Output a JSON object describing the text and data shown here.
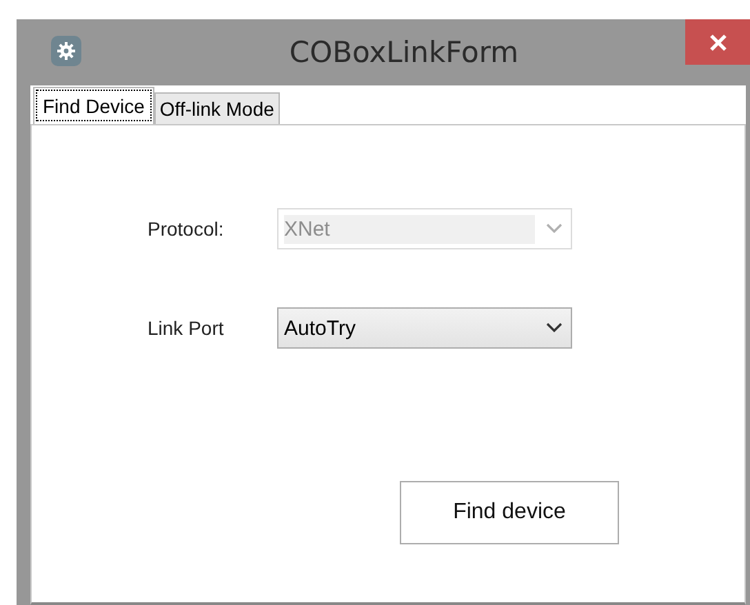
{
  "window": {
    "title": "COBoxLinkForm"
  },
  "tabs": [
    {
      "label": "Find Device",
      "selected": true
    },
    {
      "label": "Off-link Mode",
      "selected": false
    }
  ],
  "fields": [
    {
      "label": "Protocol:",
      "value": "XNet",
      "disabled": true
    },
    {
      "label": "Link Port",
      "value": "AutoTry",
      "disabled": false
    }
  ],
  "buttons": [
    "Find device"
  ]
}
